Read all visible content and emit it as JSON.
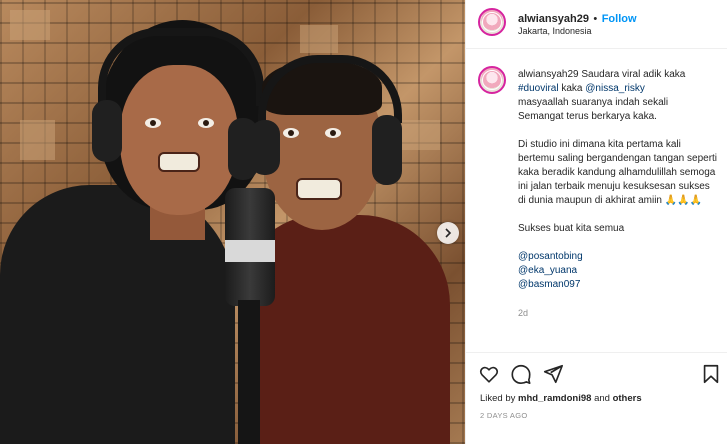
{
  "post": {
    "author": "alwiansyah29",
    "follow_label": "Follow",
    "separator": "•",
    "location": "Jakarta, Indonesia"
  },
  "caption": {
    "author": "alwiansyah29",
    "line1_text": "Saudara viral adik kaka",
    "hashtag": "#duoviral",
    "line2_mid": "kaka",
    "mention": "@nissa_risky",
    "line3": "masyaallah suaranya indah sekali",
    "line4": "Semangat terus berkarya kaka.",
    "para2": "Di studio ini dimana kita pertama kali bertemu saling bergandengan tangan seperti kaka beradik kandung alhamdulillah semoga ini jalan terbaik menuju kesuksesan sukses di dunia maupun di akhirat amiin 🙏🙏🙏",
    "para3": "Sukses buat kita semua",
    "tags": [
      "@posantobing",
      "@eka_yuana",
      "@basman097"
    ],
    "age": "2d"
  },
  "likes": {
    "prefix": "Liked by",
    "user": "mhd_ramdoni98",
    "joiner": "and",
    "others": "others"
  },
  "timestamp": "2 DAYS AGO",
  "icons": {
    "like": "heart-icon",
    "comment": "comment-icon",
    "share": "paper-plane-icon",
    "save": "bookmark-icon",
    "next": "chevron-right-icon"
  },
  "colors": {
    "follow": "#0095f6",
    "link": "#00376b",
    "muted": "#8e8e8e",
    "story_ring": "#d6249f"
  }
}
